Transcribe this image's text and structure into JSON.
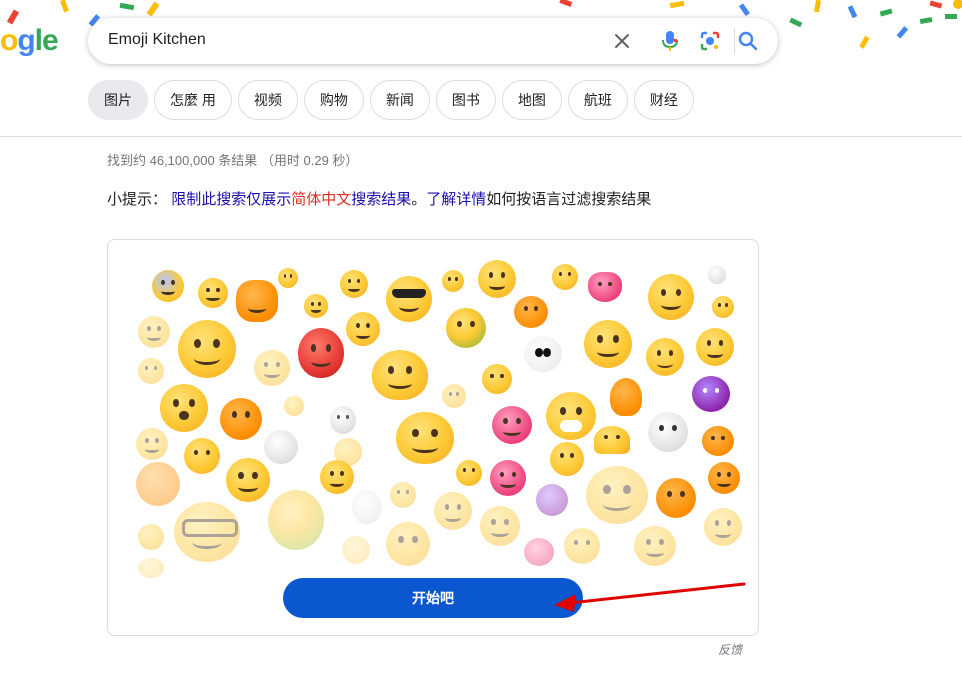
{
  "logo": {
    "part1": "o",
    "part2": "g",
    "part3": "le"
  },
  "search": {
    "query": "Emoji Kitchen",
    "clear_icon": "close-icon",
    "voice_icon": "mic-icon",
    "lens_icon": "camera-lens-icon",
    "search_icon": "search-icon"
  },
  "tabs": [
    {
      "label": "图片",
      "active": true
    },
    {
      "label": "怎麼 用",
      "active": false
    },
    {
      "label": "视频",
      "active": false
    },
    {
      "label": "购物",
      "active": false
    },
    {
      "label": "新闻",
      "active": false
    },
    {
      "label": "图书",
      "active": false
    },
    {
      "label": "地图",
      "active": false
    },
    {
      "label": "航班",
      "active": false
    },
    {
      "label": "财经",
      "active": false
    }
  ],
  "results": {
    "stats": "找到约 46,100,000 条结果 （用时 0.29 秒）"
  },
  "tip": {
    "prefix": "小提示：",
    "link1": "限制此搜索仅展示",
    "lang": "简体中文",
    "link1_suffix": "搜索结果",
    "period": "。",
    "learn_more": "了解详情",
    "suffix": "如何按语言过滤搜索结果"
  },
  "card": {
    "button_label": "开始吧"
  },
  "feedback": "反馈",
  "colors": {
    "brand_blue": "#0b57d0",
    "link": "#1a0dab",
    "lang_red": "#d93025",
    "arrow_red": "#e00000"
  }
}
